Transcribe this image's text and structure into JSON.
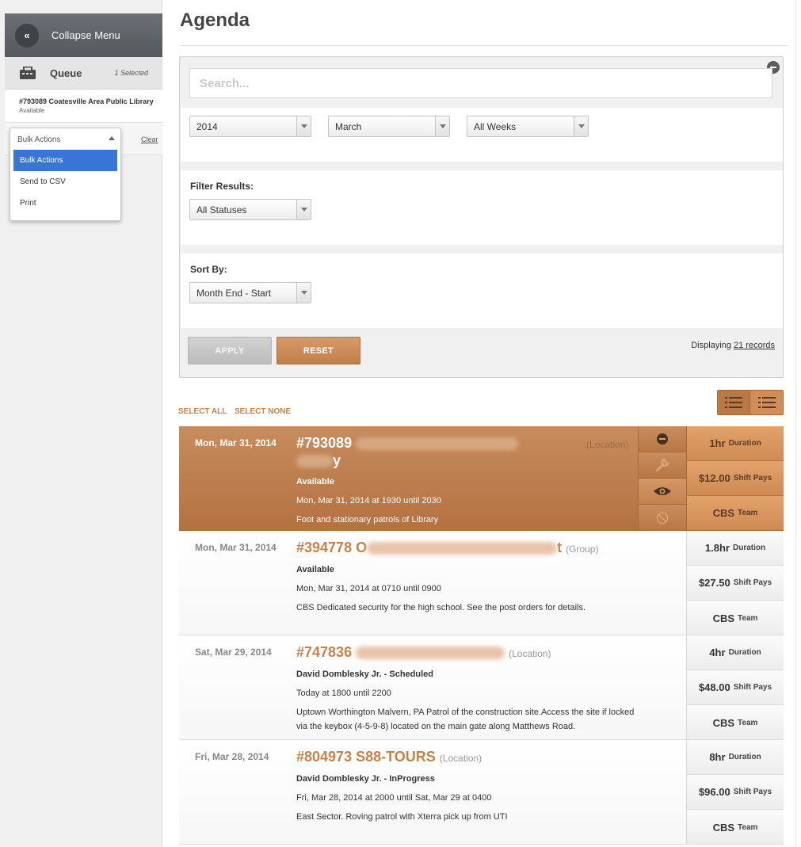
{
  "sidebar": {
    "collapse_label": "Collapse Menu",
    "collapse_glyph": "«",
    "queue_label": "Queue",
    "queue_selected": "1 Selected",
    "queue_item_title": "#793089 Coatesville Area Public Library",
    "queue_item_status": "Available",
    "bulk_selected": "Bulk Actions",
    "clear_label": "Clear",
    "bulk_options": [
      "Bulk Actions",
      "Send to CSV",
      "Print"
    ]
  },
  "main": {
    "title": "Agenda",
    "search_placeholder": "Search...",
    "year_select": "2014",
    "month_select": "March",
    "week_select": "All Weeks",
    "filter_label": "Filter Results:",
    "status_select": "All Statuses",
    "sort_label": "Sort By:",
    "sort_select": "Month End - Start",
    "apply_label": "APPLY",
    "reset_label": "RESET",
    "displaying_prefix": "Displaying",
    "displaying_link": "21 records",
    "select_all": "SELECT ALL",
    "select_none": "SELECT NONE"
  },
  "records": [
    {
      "date": "Mon, Mar 31, 2014",
      "id": "#793089",
      "title_tail": "y",
      "type": "(Location)",
      "status": "Available",
      "when": "Mon, Mar 31, 2014 at 1930 until 2030",
      "desc": "Foot and stationary patrols of Library",
      "duration": "1hr",
      "pays": "$12.00",
      "team": "CBS",
      "duration_label": "Duration",
      "pays_label": "Shift Pays",
      "team_label": "Team"
    },
    {
      "date": "Mon, Mar 31, 2014",
      "id": "#394778",
      "title_lead": "O",
      "title_tail": "t",
      "type": "(Group)",
      "status": "Available",
      "when": "Mon, Mar 31, 2014 at 0710 until 0900",
      "desc": "CBS Dedicated security for the high school. See the post orders for details.",
      "duration": "1.8hr",
      "pays": "$27.50",
      "team": "CBS",
      "duration_label": "Duration",
      "pays_label": "Shift Pays",
      "team_label": "Team"
    },
    {
      "date": "Sat, Mar 29, 2014",
      "id": "#747836",
      "type": "(Location)",
      "status": "David Domblesky Jr. - Scheduled",
      "when": "Today at 1800 until 2200",
      "desc": "Uptown Worthington Malvern, PA Patrol of the construction site.Access the site if locked via the keybox (4-5-9-8) located on the main gate along Matthews Road.",
      "duration": "4hr",
      "pays": "$48.00",
      "team": "CBS",
      "duration_label": "Duration",
      "pays_label": "Shift Pays",
      "team_label": "Team"
    },
    {
      "date": "Fri, Mar 28, 2014",
      "id": "#804973 S88-TOURS",
      "type": "(Location)",
      "status": "David Domblesky Jr. - InProgress",
      "when": "Fri, Mar 28, 2014 at 2000 until Sat, Mar 29 at 0400",
      "desc": "East Sector. Roving patrol with Xterra pick up from UTI",
      "duration": "8hr",
      "pays": "$96.00",
      "team": "CBS",
      "duration_label": "Duration",
      "pays_label": "Shift Pays",
      "team_label": "Team"
    }
  ],
  "colors": {
    "accent": "#c5834c",
    "active_row": "#b97947",
    "sidebar_header": "#5f6368",
    "dropdown_highlight": "#3875d7"
  },
  "icons": [
    "collapse-icon",
    "queue-icon",
    "minus-circle-icon",
    "list-view-icon",
    "detail-list-icon",
    "remove-icon",
    "wrench-icon",
    "eye-icon",
    "block-icon"
  ]
}
